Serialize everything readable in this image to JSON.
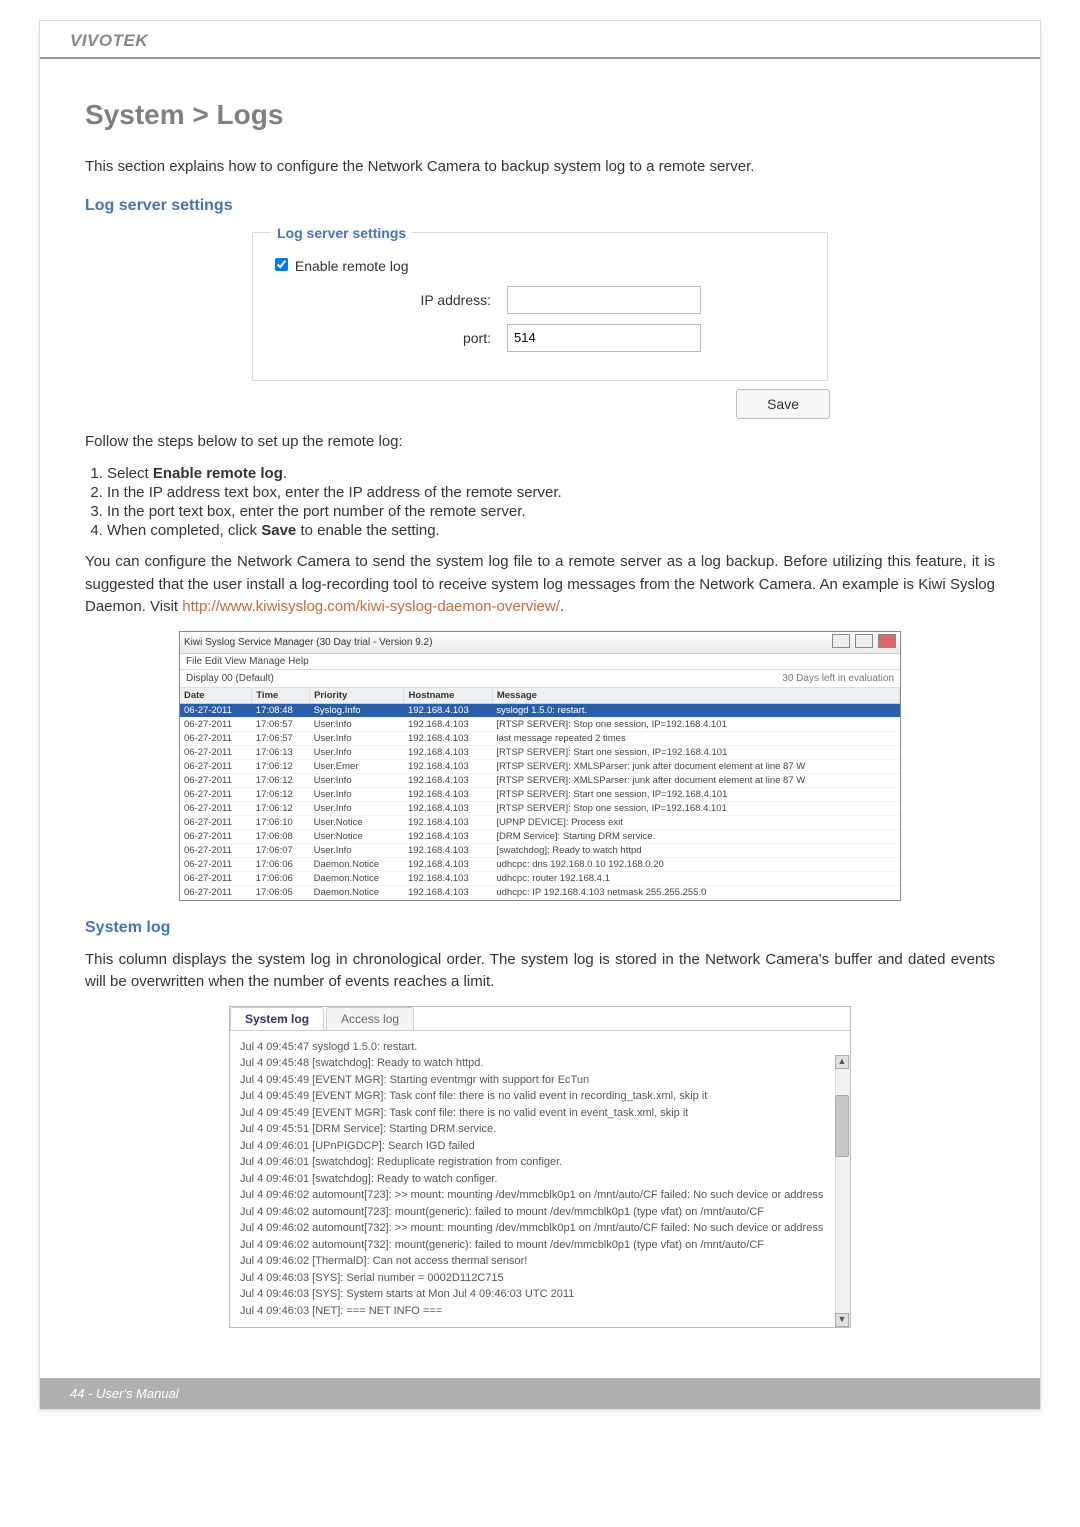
{
  "brand": "VIVOTEK",
  "title": "System > Logs",
  "intro": "This section explains how to configure the Network Camera to backup system log to a remote server.",
  "sections": {
    "log_server": "Log server settings",
    "system_log": "System log"
  },
  "form": {
    "legend": "Log server settings",
    "enable_label": "Enable remote log",
    "ip_label": "IP address:",
    "ip_value": "",
    "port_label": "port:",
    "port_value": "514",
    "save": "Save"
  },
  "steps_intro": "Follow the steps below to set up the remote log:",
  "steps": [
    "Select <b>Enable remote log</b>.",
    "In the IP address text box, enter the IP address of the remote server.",
    "In the port text box, enter the port number of the remote server.",
    "When completed, click <b>Save</b> to enable the setting."
  ],
  "backup_text_pre": "You can configure the Network Camera to send the system log file to a remote server as a log backup. Before utilizing this feature, it is suggested that the user install a log-recording tool to receive system log messages from the Network Camera. An example is Kiwi Syslog Daemon. Visit ",
  "backup_link": "http://www.kiwisyslog.com/kiwi-syslog-daemon-overview/",
  "backup_text_post": ".",
  "kiwi": {
    "title": "Kiwi Syslog Service Manager (30 Day trial - Version 9.2)",
    "menu": "File   Edit   View   Manage   Help",
    "toolbar_left": "Display 00 (Default)",
    "toolbar_right": "30 Days left in evaluation",
    "headers": [
      "Date",
      "Time",
      "Priority",
      "Hostname",
      "Message"
    ],
    "rows": [
      {
        "hl": true,
        "c": [
          "06-27-2011",
          "17:08:48",
          "Syslog.Info",
          "192.168.4.103",
          "syslogd 1.5.0: restart."
        ]
      },
      {
        "c": [
          "06-27-2011",
          "17:06:57",
          "User.Info",
          "192.168.4.103",
          "[RTSP SERVER]: Stop one session, IP=192.168.4.101"
        ]
      },
      {
        "c": [
          "06-27-2011",
          "17:06:57",
          "User.Info",
          "192.168.4.103",
          "last message repeated 2 times"
        ]
      },
      {
        "c": [
          "06-27-2011",
          "17:06:13",
          "User.Info",
          "192.168.4.103",
          "[RTSP SERVER]: Start one session, IP=192.168.4.101"
        ]
      },
      {
        "c": [
          "06-27-2011",
          "17:06:12",
          "User.Emer",
          "192.168.4.103",
          "[RTSP SERVER]: XMLSParser: junk after document element at line 87 W"
        ]
      },
      {
        "c": [
          "06-27-2011",
          "17:06:12",
          "User.Info",
          "192.168.4.103",
          "[RTSP SERVER]: XMLSParser: junk after document element at line 87 W"
        ]
      },
      {
        "c": [
          "06-27-2011",
          "17:06:12",
          "User.Info",
          "192.168.4.103",
          "[RTSP SERVER]: Start one session, IP=192.168.4.101"
        ]
      },
      {
        "c": [
          "06-27-2011",
          "17:06:12",
          "User.Info",
          "192.168.4.103",
          "[RTSP SERVER]: Stop one session, IP=192.168.4.101"
        ]
      },
      {
        "c": [
          "06-27-2011",
          "17:06:10",
          "User.Notice",
          "192.168.4.103",
          "[UPNP DEVICE]: Process exit"
        ]
      },
      {
        "c": [
          "06-27-2011",
          "17:06:08",
          "User.Notice",
          "192.168.4.103",
          "[DRM Service]: Starting DRM service."
        ]
      },
      {
        "c": [
          "06-27-2011",
          "17:06:07",
          "User.Info",
          "192.168.4.103",
          "[swatchdog]: Ready to watch httpd"
        ]
      },
      {
        "c": [
          "06-27-2011",
          "17:06:06",
          "Daemon.Notice",
          "192.168.4.103",
          "udhcpc: dns 192.168.0.10 192.168.0.20"
        ]
      },
      {
        "c": [
          "06-27-2011",
          "17:06:06",
          "Daemon.Notice",
          "192.168.4.103",
          "udhcpc: router 192.168.4.1"
        ]
      },
      {
        "c": [
          "06-27-2011",
          "17:06:05",
          "Daemon.Notice",
          "192.168.4.103",
          "udhcpc: IP 192.168.4.103 netmask 255.255.255.0"
        ]
      }
    ]
  },
  "syslog_desc": "This column displays the system log in chronological order. The system log is stored in the Network Camera's buffer and dated events will be overwritten when the number of events reaches a limit.",
  "tabs": {
    "active": "System log",
    "other": "Access log"
  },
  "log_lines": [
    "Jul 4 09:45:47 syslogd 1.5.0: restart.",
    "Jul 4 09:45:48 [swatchdog]: Ready to watch httpd.",
    "Jul 4 09:45:49 [EVENT MGR]: Starting eventmgr with support for EcTun",
    "Jul 4 09:45:49 [EVENT MGR]: Task conf file: there is no valid event in recording_task.xml, skip it",
    "Jul 4 09:45:49 [EVENT MGR]: Task conf file: there is no valid event in event_task.xml, skip it",
    "Jul 4 09:45:51 [DRM Service]: Starting DRM service.",
    "Jul 4 09:46:01 [UPnPIGDCP]: Search IGD failed",
    "Jul 4 09:46:01 [swatchdog]: Reduplicate registration from configer.",
    "Jul 4 09:46:01 [swatchdog]: Ready to watch configer.",
    "Jul 4 09:46:02 automount[723]: >> mount: mounting /dev/mmcblk0p1 on /mnt/auto/CF failed: No such device or address",
    "Jul 4 09:46:02 automount[723]: mount(generic): failed to mount /dev/mmcblk0p1 (type vfat) on /mnt/auto/CF",
    "Jul 4 09:46:02 automount[732]: >> mount: mounting /dev/mmcblk0p1 on /mnt/auto/CF failed: No such device or address",
    "Jul 4 09:46:02 automount[732]: mount(generic): failed to mount /dev/mmcblk0p1 (type vfat) on /mnt/auto/CF",
    "Jul 4 09:46:02 [ThermalD]: Can not access thermal sensor!",
    "Jul 4 09:46:03 [SYS]: Serial number = 0002D112C715",
    "Jul 4 09:46:03 [SYS]: System starts at Mon Jul 4 09:46:03 UTC 2011",
    "Jul 4 09:46:03 [NET]: === NET INFO ==="
  ],
  "footer": "44 - User's Manual"
}
